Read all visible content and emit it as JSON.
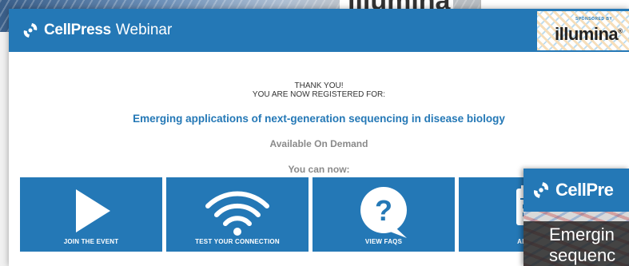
{
  "background": {
    "illumina_text": "illumina"
  },
  "header": {
    "brand": "CellPress",
    "brand_suffix": "Webinar",
    "sponsor_label": "SPONSORED BY",
    "sponsor_name": "illumina",
    "sponsor_mark": "®"
  },
  "main": {
    "thank_you": "THANK YOU!",
    "registered": "YOU ARE NOW REGISTERED FOR:",
    "event_title": "Emerging applications of next-generation sequencing in disease biology",
    "availability": "Available On Demand",
    "you_can_now": "You can now:",
    "tiles": [
      {
        "label": "JOIN THE EVENT",
        "icon": "play-icon"
      },
      {
        "label": "TEST YOUR CONNECTION",
        "icon": "wifi-icon"
      },
      {
        "label": "VIEW FAQS",
        "icon": "question-bubble-icon"
      },
      {
        "label": "ADD TO",
        "icon": "calendar-icon"
      }
    ]
  },
  "overlay": {
    "brand": "CellPre",
    "line1": "Emergin",
    "line2": "sequenc"
  },
  "colors": {
    "primary": "#2478b6",
    "muted_text": "#8a8a8a"
  }
}
